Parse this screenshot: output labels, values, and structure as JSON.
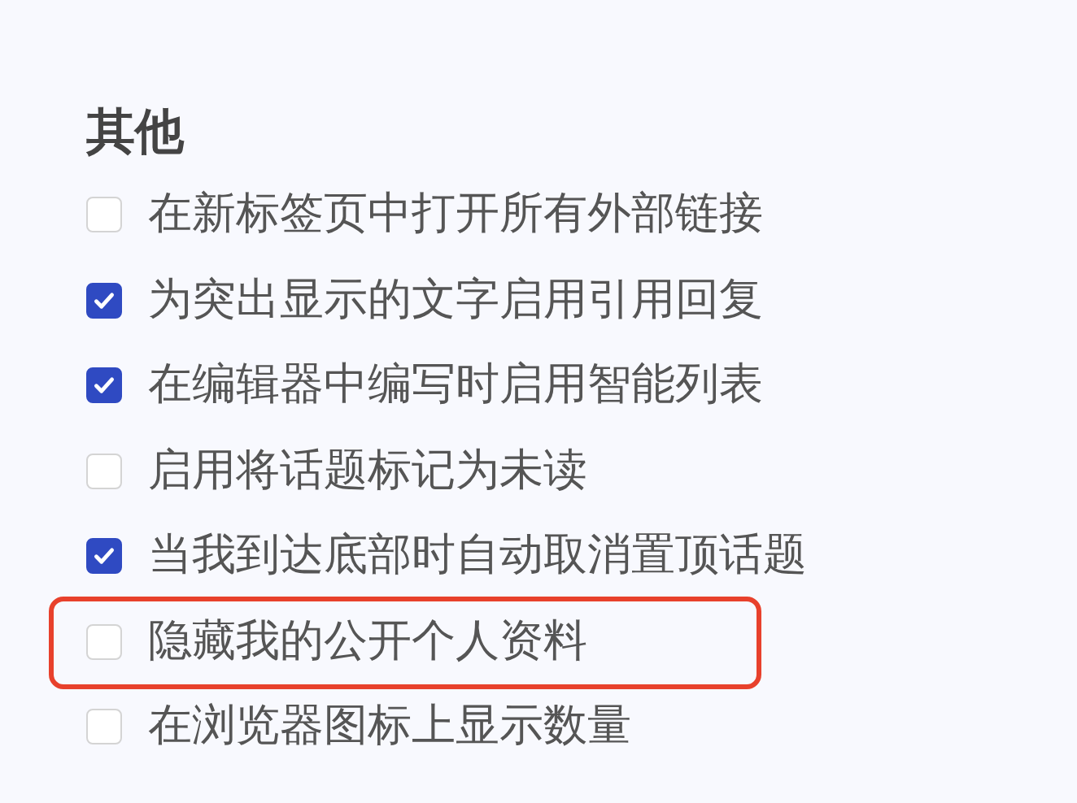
{
  "section": {
    "title": "其他",
    "options": [
      {
        "label": "在新标签页中打开所有外部链接",
        "checked": false,
        "highlighted": false
      },
      {
        "label": "为突出显示的文字启用引用回复",
        "checked": true,
        "highlighted": false
      },
      {
        "label": "在编辑器中编写时启用智能列表",
        "checked": true,
        "highlighted": false
      },
      {
        "label": "启用将话题标记为未读",
        "checked": false,
        "highlighted": false
      },
      {
        "label": "当我到达底部时自动取消置顶话题",
        "checked": true,
        "highlighted": false
      },
      {
        "label": "隐藏我的公开个人资料",
        "checked": false,
        "highlighted": true
      },
      {
        "label": "在浏览器图标上显示数量",
        "checked": false,
        "highlighted": false
      }
    ]
  }
}
